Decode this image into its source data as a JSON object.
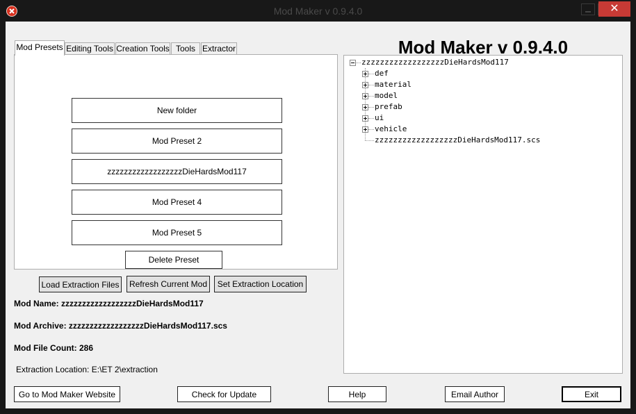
{
  "window": {
    "title": "Mod Maker v 0.9.4.0",
    "close_glyph": "✕"
  },
  "heading": "Mod Maker v 0.9.4.0",
  "tabs": [
    "Mod Presets",
    "Editing Tools",
    "Creation Tools",
    "Tools",
    "Extractor"
  ],
  "presets": [
    "New folder",
    "Mod Preset 2",
    "zzzzzzzzzzzzzzzzzzDieHardsMod117",
    "Mod Preset 4",
    "Mod Preset 5"
  ],
  "delete_preset": "Delete Preset",
  "actions": {
    "load": "Load Extraction Files",
    "refresh": "Refresh Current Mod",
    "set_location": "Set Extraction Location"
  },
  "info": {
    "mod_name_label": "Mod Name:",
    "mod_name": "zzzzzzzzzzzzzzzzzzDieHardsMod117",
    "mod_archive_label": "Mod Archive:",
    "mod_archive": "zzzzzzzzzzzzzzzzzzDieHardsMod117.scs",
    "file_count_label": "Mod File Count:",
    "file_count": "286",
    "extraction_location": "Extraction Location: E:\\ET 2\\extraction"
  },
  "tree": {
    "root": "zzzzzzzzzzzzzzzzzzDieHardsMod117",
    "children": [
      "def",
      "material",
      "model",
      "prefab",
      "ui",
      "vehicle"
    ],
    "file": "zzzzzzzzzzzzzzzzzzDieHardsMod117.scs"
  },
  "footer": {
    "website": "Go to Mod Maker Website",
    "update": "Check for Update",
    "help": "Help",
    "email": "Email Author",
    "exit": "Exit"
  },
  "colors": {
    "titlebar": "#181818",
    "close": "#c73a35",
    "client": "#f0f0f0"
  },
  "icons": {
    "app": "app-logo-icon",
    "close": "close-icon",
    "minimize": "minimize-icon",
    "maximize": "maximize-icon"
  }
}
